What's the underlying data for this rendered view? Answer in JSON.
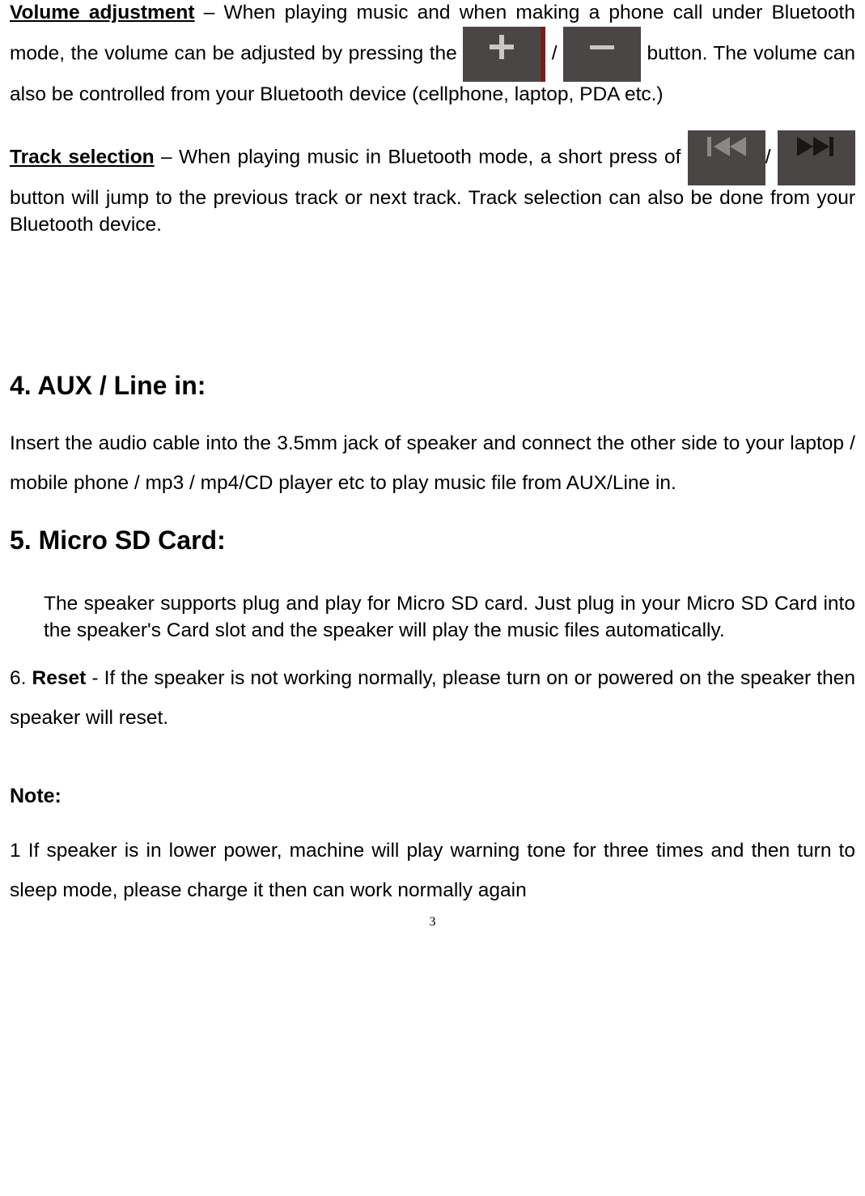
{
  "volume": {
    "label": "Volume adjustment",
    "text_a": " – When playing music and when making a phone call under Bluetooth mode, the volume can be adjusted by pressing the ",
    "sep": " / ",
    "text_b": " button. The volume can also be controlled from your Bluetooth device (cellphone, laptop, PDA etc.)"
  },
  "track": {
    "label": "Track selection",
    "text_a": " – When playing music in Bluetooth mode, a short press of ",
    "sep": "/   ",
    "text_b": " button will jump to the previous track or next track.   Track selection can also be done from your Bluetooth device."
  },
  "aux": {
    "heading": "4. AUX / Line in:",
    "body": "Insert the audio cable into the 3.5mm jack of speaker and connect the other side to your laptop / mobile phone / mp3 / mp4/CD player etc to play music file from AUX/Line in."
  },
  "sd": {
    "heading": "5. Micro SD Card:",
    "body": "The speaker supports plug and play for Micro SD card. Just plug in your Micro SD Card into the speaker's Card slot and the speaker will play the music files automatically."
  },
  "reset": {
    "prefix": "6.  ",
    "label": "Reset",
    "body": " - If the speaker is not working normally, please turn on or powered on the speaker then speaker will reset."
  },
  "note": {
    "heading": "Note:",
    "body": " 1 If speaker is in lower power, machine will play warning tone for three times and then turn to sleep mode, please charge it then can work normally again"
  },
  "page_number": "3"
}
